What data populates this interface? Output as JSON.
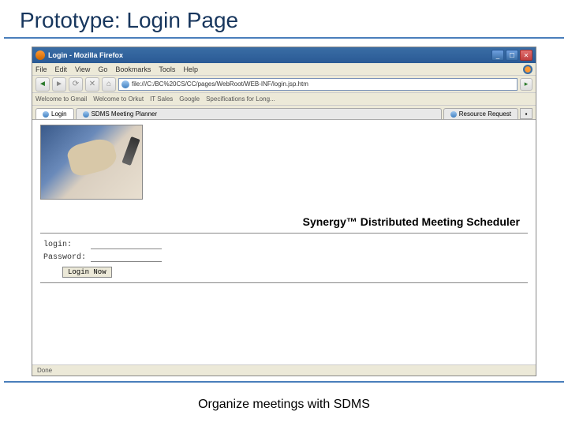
{
  "slide_title": "Prototype: Login Page",
  "footer": "Organize meetings with SDMS",
  "titlebar": {
    "text": "Login - Mozilla Firefox"
  },
  "menubar": {
    "items": [
      "File",
      "Edit",
      "View",
      "Go",
      "Bookmarks",
      "Tools",
      "Help"
    ]
  },
  "addr": {
    "url": "file:///C:/BC%20CS/CC/pages/WebRoot/WEB-INF/login.jsp.htm"
  },
  "bookmarks": {
    "items": [
      "Welcome to Gmail",
      "Welcome to Orkut",
      "IT Sales",
      "Google",
      "Specifications for Long..."
    ]
  },
  "tabs": {
    "items": [
      {
        "label": "Login"
      },
      {
        "label": "SDMS Meeting Planner"
      },
      {
        "label": "Resource Request"
      }
    ]
  },
  "page": {
    "brand": "Synergy™ Distributed Meeting Scheduler",
    "login_label": "login:",
    "password_label": "Password:",
    "submit": "Login Now"
  },
  "statusbar": {
    "text": "Done"
  }
}
